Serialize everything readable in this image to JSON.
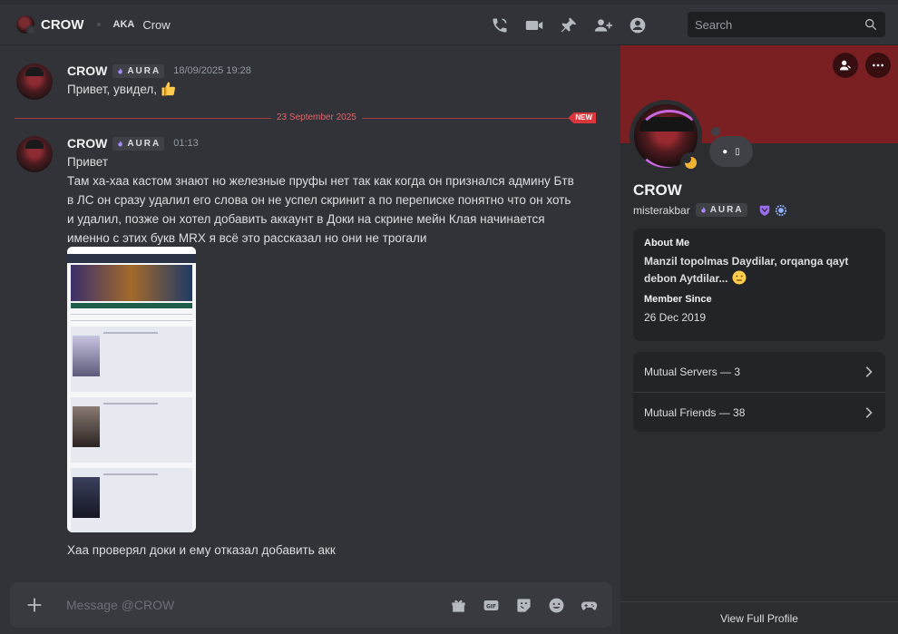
{
  "topbar": {
    "channel_name": "CROW",
    "aka_label": "AKA",
    "aka_value": "Crow",
    "icons": [
      "phone-call-icon",
      "video-call-icon",
      "pin-icon",
      "add-friend-icon",
      "profile-toggle-icon"
    ],
    "search_placeholder": "Search"
  },
  "messages": [
    {
      "author": "CROW",
      "tag": "AURA",
      "time": "18/09/2025 19:28",
      "text": "Привет, увидел,"
    },
    {
      "author": "CROW",
      "tag": "AURA",
      "time": "01:13",
      "lines": [
        "Привет",
        "Там ха-хаа кастом знают но железные пруфы нет так как когда он признался админу Бтв",
        "в ЛС он сразу удалил его слова он не успел скринит а по переписке понятно что он хоть",
        "и удалил, позже он хотел добавить аккаунт в Доки на скрине мейн Клая начинается",
        "именно с этих букв MRX я всё это рассказал но они не трогали"
      ],
      "after_image": "Хаа проверял доки и ему отказал добавить акк"
    }
  ],
  "divider": {
    "date": "23 September 2025",
    "new_label": "NEW"
  },
  "composer": {
    "placeholder": "Message @CROW",
    "icons": [
      "gift-icon",
      "gif-icon",
      "sticker-icon",
      "emoji-icon",
      "game-icon"
    ]
  },
  "profile": {
    "display_name": "CROW",
    "username": "misterakbar",
    "tag": "AURA",
    "about_title": "About Me",
    "bio": "Manzil topolmas Daydilar, orqanga qayt debon Aytdilar...",
    "member_since_title": "Member Since",
    "member_since": "26 Dec 2019",
    "mutual_servers": "Mutual Servers — 3",
    "mutual_friends": "Mutual Friends — 38",
    "view_full": "View Full Profile",
    "banner_color": "#7a1f22",
    "status_color": "#f0b232"
  },
  "colors": {
    "bg": "#313338",
    "sidebar": "#2b2d31",
    "accent_red": "#da373c"
  }
}
